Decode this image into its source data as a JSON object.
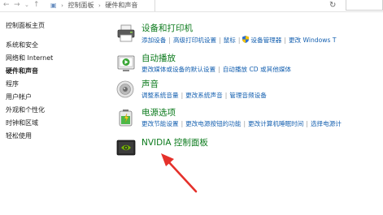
{
  "address_bar": {
    "crumbs": [
      "控制面板",
      "硬件和声音"
    ]
  },
  "sidebar": {
    "items": [
      {
        "label": "控制面板主页",
        "current": false
      },
      {
        "label": "系统和安全",
        "current": false
      },
      {
        "label": "网络和 Internet",
        "current": false
      },
      {
        "label": "硬件和声音",
        "current": true
      },
      {
        "label": "程序",
        "current": false
      },
      {
        "label": "用户帐户",
        "current": false
      },
      {
        "label": "外观和个性化",
        "current": false
      },
      {
        "label": "时钟和区域",
        "current": false
      },
      {
        "label": "轻松使用",
        "current": false
      }
    ]
  },
  "categories": [
    {
      "title": "设备和打印机",
      "icon": "printer-icon",
      "links": [
        "添加设备",
        "高级打印机设置",
        "鼠标",
        "设备管理器",
        "更改 Windows T"
      ]
    },
    {
      "title": "自动播放",
      "icon": "autoplay-icon",
      "links": [
        "更改媒体或设备的默认设置",
        "自动播放 CD 或其他媒体"
      ]
    },
    {
      "title": "声音",
      "icon": "speaker-icon",
      "links": [
        "调整系统音量",
        "更改系统声音",
        "管理音频设备"
      ]
    },
    {
      "title": "电源选项",
      "icon": "battery-icon",
      "links": [
        "更改节能设置",
        "更改电源按钮的功能",
        "更改计算机睡眠时间",
        "选择电源计"
      ]
    },
    {
      "title": "NVIDIA 控制面板",
      "icon": "nvidia-icon",
      "links": []
    }
  ],
  "colors": {
    "category_title": "#0b7a1c",
    "link": "#1560b0",
    "arrow": "#e5312b"
  }
}
